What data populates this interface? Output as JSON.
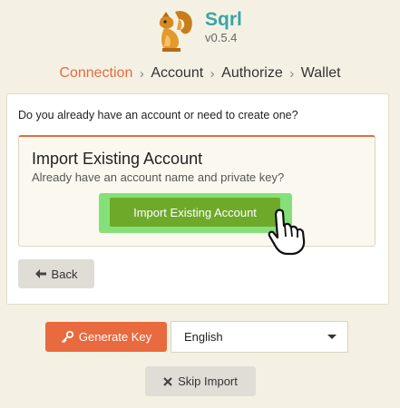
{
  "app": {
    "name": "Sqrl",
    "version": "v0.5.4",
    "logo_icon": "squirrel-logo-icon"
  },
  "steps": [
    {
      "label": "Connection",
      "active": true
    },
    {
      "label": "Account",
      "active": false
    },
    {
      "label": "Authorize",
      "active": false
    },
    {
      "label": "Wallet",
      "active": false
    }
  ],
  "panel": {
    "question": "Do you already have an account or need to create one?",
    "card_title": "Import Existing Account",
    "card_subtitle": "Already have an account name and private key?",
    "import_button": "Import Existing Account",
    "back_button": "Back"
  },
  "footer": {
    "generate_button": "Generate Key",
    "language_selected": "English",
    "skip_button": "Skip Import"
  },
  "colors": {
    "accent": "#e86a3e",
    "brand": "#3aa5a3",
    "import_button": "#6fa92a",
    "highlight": "#86e07a"
  }
}
